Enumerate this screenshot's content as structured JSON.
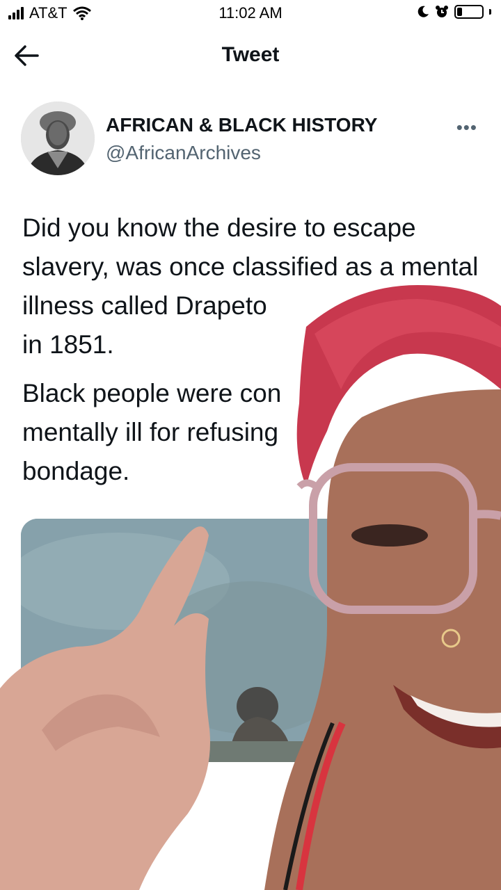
{
  "status_bar": {
    "carrier": "AT&T",
    "time": "11:02 AM",
    "battery_level": 0.2
  },
  "nav": {
    "back_icon": "arrow-left-icon",
    "title": "Tweet"
  },
  "tweet": {
    "author": {
      "display_name": "AFRICAN & BLACK HISTORY",
      "handle": "@AfricanArchives",
      "avatar": "portrait-photo"
    },
    "more_icon": "more-horizontal-icon",
    "paragraphs": [
      "Did you know the desire to escape slavery, was once classified as a mental illness called Drapeto",
      "in 1851.",
      "Black people were con",
      "mentally ill for refusing",
      "bondage."
    ],
    "media": "painting-image"
  },
  "overlay": {
    "content": "person-selfie-video",
    "colors": {
      "hair": "#c8384e",
      "skin": "#a8705a",
      "glasses": "#c9a0a8"
    }
  }
}
